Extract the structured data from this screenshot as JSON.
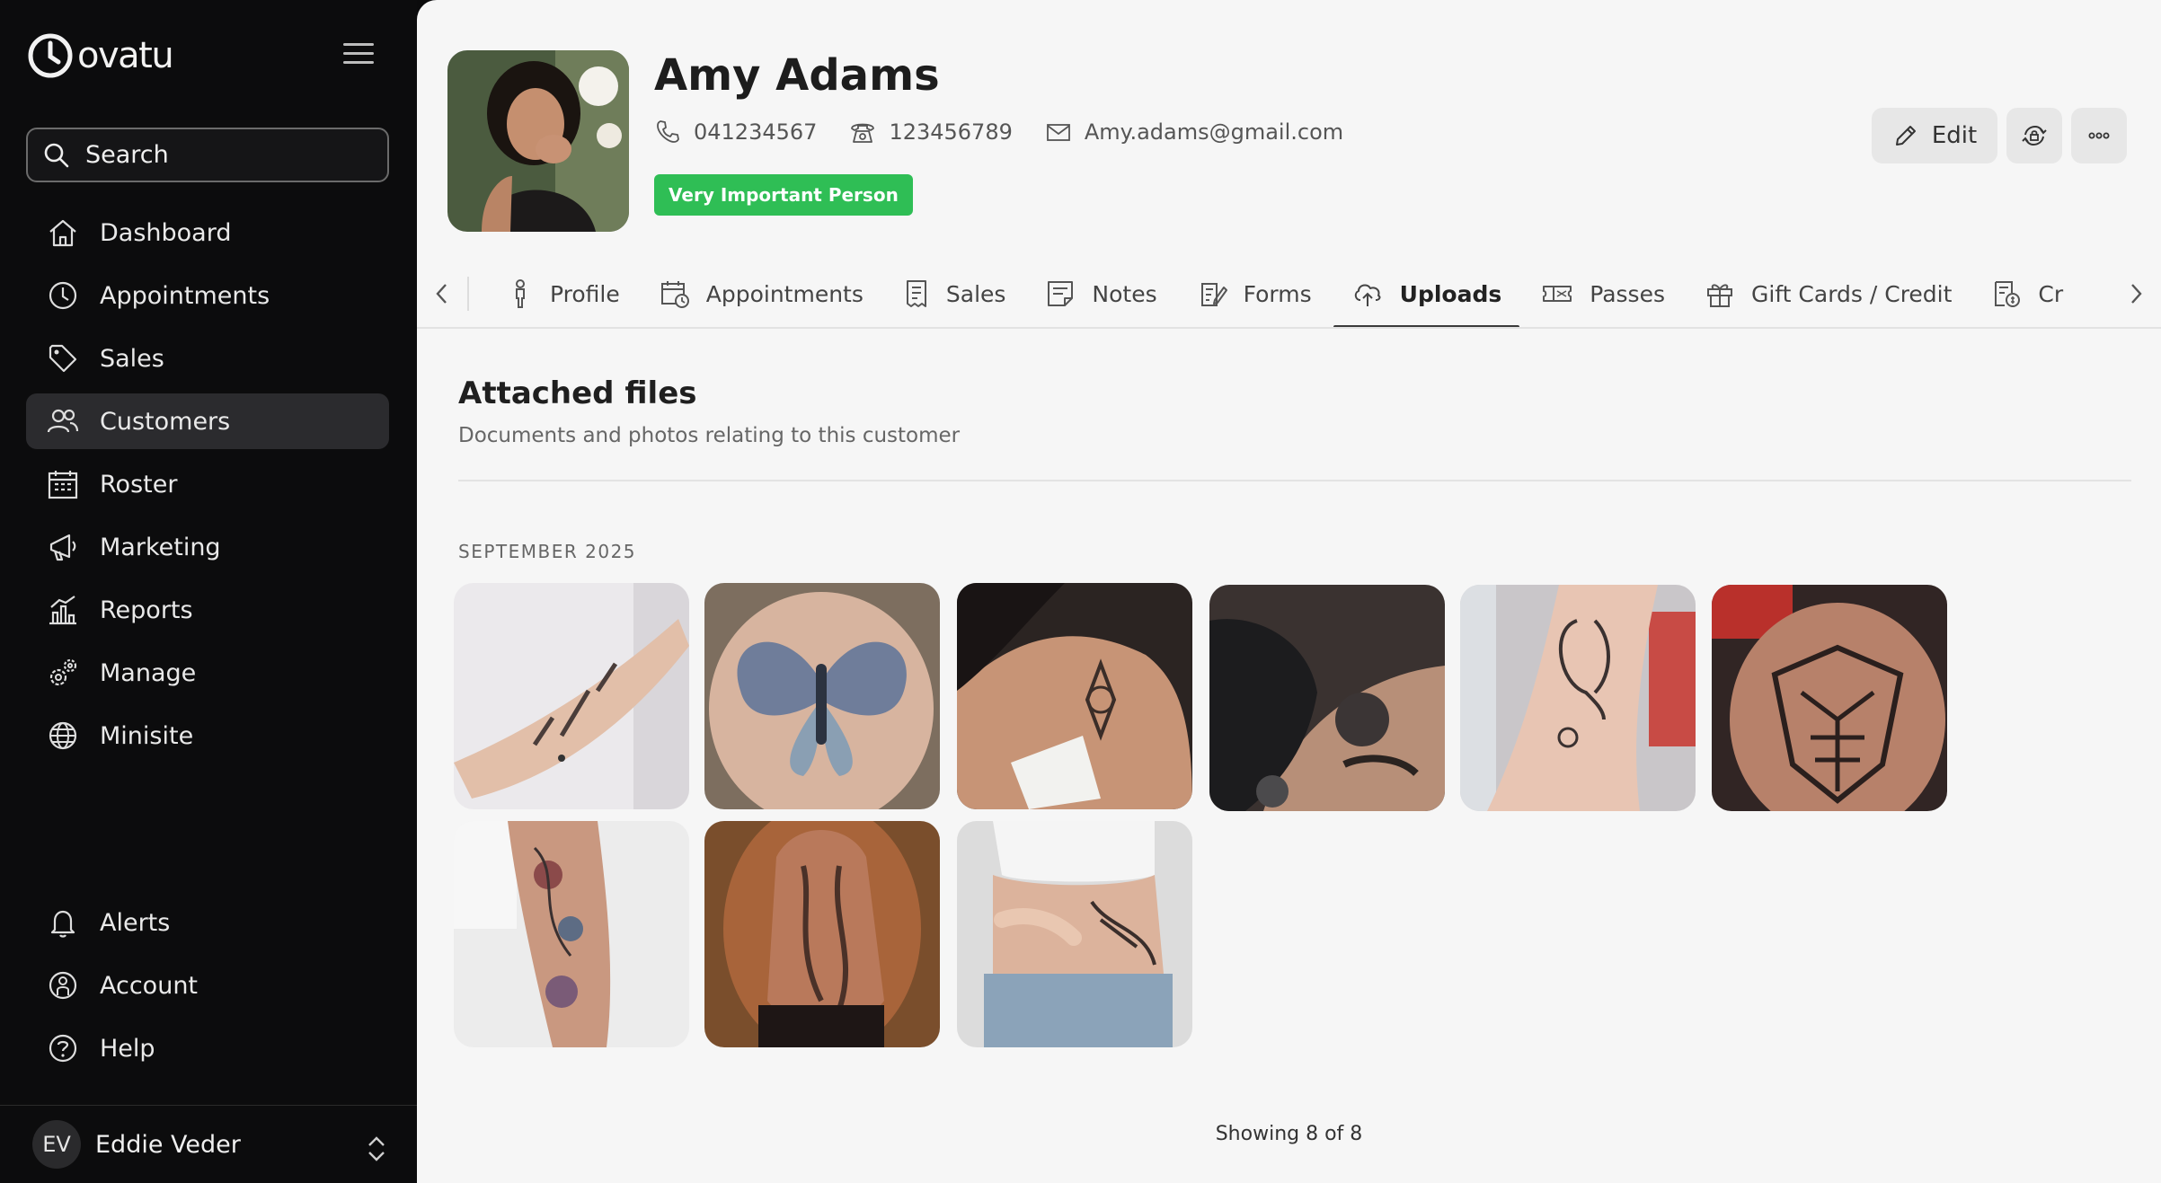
{
  "app": {
    "logo_text": "ovatu"
  },
  "sidebar": {
    "search_label": "Search",
    "items": [
      {
        "label": "Dashboard",
        "icon": "home-icon"
      },
      {
        "label": "Appointments",
        "icon": "clock-icon"
      },
      {
        "label": "Sales",
        "icon": "tag-icon"
      },
      {
        "label": "Customers",
        "icon": "users-icon",
        "active": true
      },
      {
        "label": "Roster",
        "icon": "calendar-grid-icon"
      },
      {
        "label": "Marketing",
        "icon": "megaphone-icon"
      },
      {
        "label": "Reports",
        "icon": "bar-chart-icon"
      },
      {
        "label": "Manage",
        "icon": "gears-icon"
      },
      {
        "label": "Minisite",
        "icon": "globe-icon"
      }
    ],
    "bottom_items": [
      {
        "label": "Alerts",
        "icon": "bell-icon"
      },
      {
        "label": "Account",
        "icon": "account-icon"
      },
      {
        "label": "Help",
        "icon": "help-icon"
      }
    ],
    "user": {
      "initials": "EV",
      "name": "Eddie Veder"
    }
  },
  "customer": {
    "name": "Amy Adams",
    "phone": "041234567",
    "landline": "123456789",
    "email": "Amy.adams@gmail.com",
    "badge": "Very Important Person"
  },
  "actions": {
    "edit_label": "Edit"
  },
  "tabs": [
    {
      "label": "Profile",
      "icon": "person-icon"
    },
    {
      "label": "Appointments",
      "icon": "calendar-clock-icon"
    },
    {
      "label": "Sales",
      "icon": "receipt-icon"
    },
    {
      "label": "Notes",
      "icon": "note-icon"
    },
    {
      "label": "Forms",
      "icon": "form-icon"
    },
    {
      "label": "Uploads",
      "icon": "cloud-upload-icon",
      "active": true
    },
    {
      "label": "Passes",
      "icon": "ticket-icon"
    },
    {
      "label": "Gift Cards / Credit",
      "icon": "gift-icon"
    },
    {
      "label": "Cr",
      "icon": "credit-icon"
    }
  ],
  "section": {
    "title": "Attached files",
    "subtitle": "Documents and photos relating to this customer",
    "month": "SEPTEMBER 2025",
    "count_text": "Showing 8 of 8"
  },
  "colors": {
    "accent_green": "#2fbe55",
    "sidebar_bg": "#0c0c0d",
    "main_bg": "#f6f6f6"
  }
}
